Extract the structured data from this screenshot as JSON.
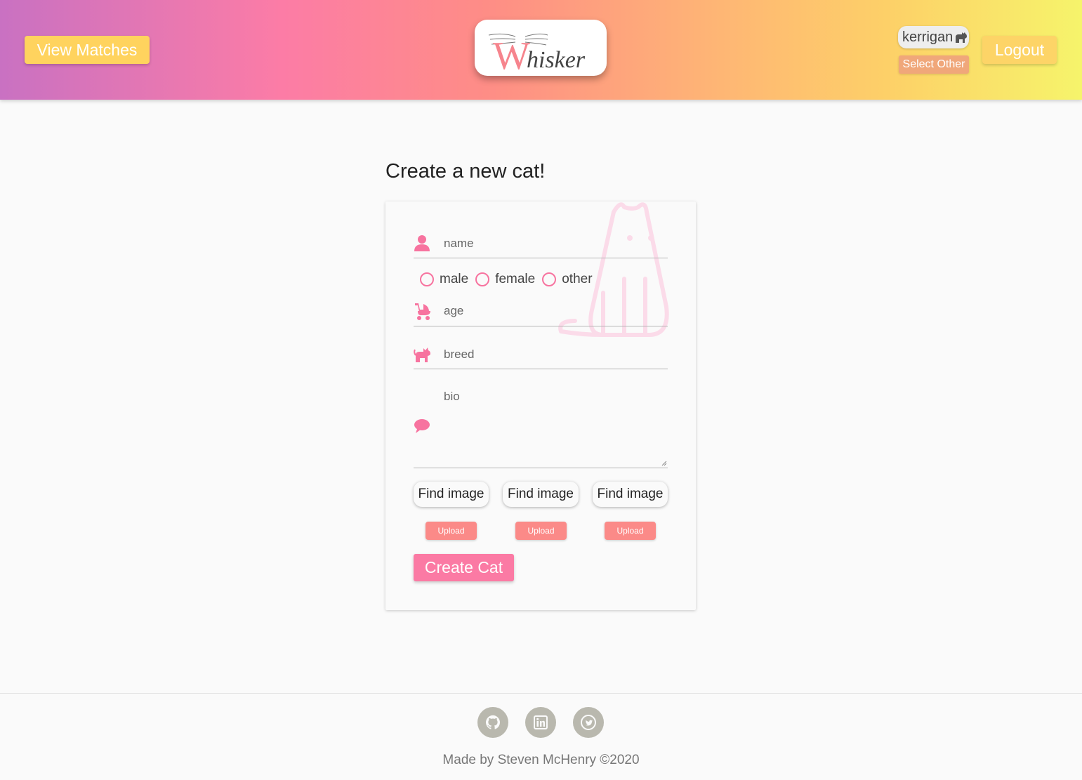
{
  "header": {
    "view_matches_label": "View Matches",
    "logo_text": "hisker",
    "logo_letter": "W",
    "current_cat": "kerrigan",
    "select_other_label": "Select Other",
    "logout_label": "Logout"
  },
  "main": {
    "title": "Create a new cat!",
    "form": {
      "name_placeholder": "name",
      "gender_options": [
        "male",
        "female",
        "other"
      ],
      "age_placeholder": "age",
      "breed_placeholder": "breed",
      "bio_placeholder": "bio",
      "find_image_labels": [
        "Find image",
        "Find image",
        "Find image"
      ],
      "upload_labels": [
        "Upload",
        "Upload",
        "Upload"
      ],
      "create_label": "Create Cat"
    }
  },
  "footer": {
    "social_icons": [
      "github-icon",
      "linkedin-icon",
      "twitter-icon"
    ],
    "credit": "Made by Steven McHenry ©2020"
  },
  "colors": {
    "accent_pink": "#fb7aa4",
    "icon_pink": "#f7739f",
    "button_yellow": "#ffd35e",
    "upload_salmon": "#fb8a88",
    "social_grey": "#b9b8ae"
  }
}
